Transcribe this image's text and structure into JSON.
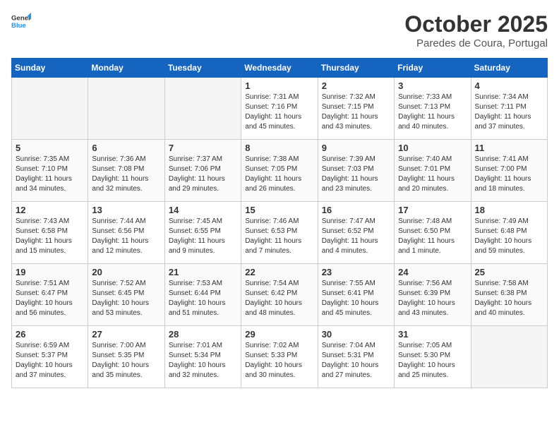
{
  "header": {
    "logo_general": "General",
    "logo_blue": "Blue",
    "month_title": "October 2025",
    "subtitle": "Paredes de Coura, Portugal"
  },
  "weekdays": [
    "Sunday",
    "Monday",
    "Tuesday",
    "Wednesday",
    "Thursday",
    "Friday",
    "Saturday"
  ],
  "weeks": [
    [
      {
        "day": "",
        "info": ""
      },
      {
        "day": "",
        "info": ""
      },
      {
        "day": "",
        "info": ""
      },
      {
        "day": "1",
        "info": "Sunrise: 7:31 AM\nSunset: 7:16 PM\nDaylight: 11 hours\nand 45 minutes."
      },
      {
        "day": "2",
        "info": "Sunrise: 7:32 AM\nSunset: 7:15 PM\nDaylight: 11 hours\nand 43 minutes."
      },
      {
        "day": "3",
        "info": "Sunrise: 7:33 AM\nSunset: 7:13 PM\nDaylight: 11 hours\nand 40 minutes."
      },
      {
        "day": "4",
        "info": "Sunrise: 7:34 AM\nSunset: 7:11 PM\nDaylight: 11 hours\nand 37 minutes."
      }
    ],
    [
      {
        "day": "5",
        "info": "Sunrise: 7:35 AM\nSunset: 7:10 PM\nDaylight: 11 hours\nand 34 minutes."
      },
      {
        "day": "6",
        "info": "Sunrise: 7:36 AM\nSunset: 7:08 PM\nDaylight: 11 hours\nand 32 minutes."
      },
      {
        "day": "7",
        "info": "Sunrise: 7:37 AM\nSunset: 7:06 PM\nDaylight: 11 hours\nand 29 minutes."
      },
      {
        "day": "8",
        "info": "Sunrise: 7:38 AM\nSunset: 7:05 PM\nDaylight: 11 hours\nand 26 minutes."
      },
      {
        "day": "9",
        "info": "Sunrise: 7:39 AM\nSunset: 7:03 PM\nDaylight: 11 hours\nand 23 minutes."
      },
      {
        "day": "10",
        "info": "Sunrise: 7:40 AM\nSunset: 7:01 PM\nDaylight: 11 hours\nand 20 minutes."
      },
      {
        "day": "11",
        "info": "Sunrise: 7:41 AM\nSunset: 7:00 PM\nDaylight: 11 hours\nand 18 minutes."
      }
    ],
    [
      {
        "day": "12",
        "info": "Sunrise: 7:43 AM\nSunset: 6:58 PM\nDaylight: 11 hours\nand 15 minutes."
      },
      {
        "day": "13",
        "info": "Sunrise: 7:44 AM\nSunset: 6:56 PM\nDaylight: 11 hours\nand 12 minutes."
      },
      {
        "day": "14",
        "info": "Sunrise: 7:45 AM\nSunset: 6:55 PM\nDaylight: 11 hours\nand 9 minutes."
      },
      {
        "day": "15",
        "info": "Sunrise: 7:46 AM\nSunset: 6:53 PM\nDaylight: 11 hours\nand 7 minutes."
      },
      {
        "day": "16",
        "info": "Sunrise: 7:47 AM\nSunset: 6:52 PM\nDaylight: 11 hours\nand 4 minutes."
      },
      {
        "day": "17",
        "info": "Sunrise: 7:48 AM\nSunset: 6:50 PM\nDaylight: 11 hours\nand 1 minute."
      },
      {
        "day": "18",
        "info": "Sunrise: 7:49 AM\nSunset: 6:48 PM\nDaylight: 10 hours\nand 59 minutes."
      }
    ],
    [
      {
        "day": "19",
        "info": "Sunrise: 7:51 AM\nSunset: 6:47 PM\nDaylight: 10 hours\nand 56 minutes."
      },
      {
        "day": "20",
        "info": "Sunrise: 7:52 AM\nSunset: 6:45 PM\nDaylight: 10 hours\nand 53 minutes."
      },
      {
        "day": "21",
        "info": "Sunrise: 7:53 AM\nSunset: 6:44 PM\nDaylight: 10 hours\nand 51 minutes."
      },
      {
        "day": "22",
        "info": "Sunrise: 7:54 AM\nSunset: 6:42 PM\nDaylight: 10 hours\nand 48 minutes."
      },
      {
        "day": "23",
        "info": "Sunrise: 7:55 AM\nSunset: 6:41 PM\nDaylight: 10 hours\nand 45 minutes."
      },
      {
        "day": "24",
        "info": "Sunrise: 7:56 AM\nSunset: 6:39 PM\nDaylight: 10 hours\nand 43 minutes."
      },
      {
        "day": "25",
        "info": "Sunrise: 7:58 AM\nSunset: 6:38 PM\nDaylight: 10 hours\nand 40 minutes."
      }
    ],
    [
      {
        "day": "26",
        "info": "Sunrise: 6:59 AM\nSunset: 5:37 PM\nDaylight: 10 hours\nand 37 minutes."
      },
      {
        "day": "27",
        "info": "Sunrise: 7:00 AM\nSunset: 5:35 PM\nDaylight: 10 hours\nand 35 minutes."
      },
      {
        "day": "28",
        "info": "Sunrise: 7:01 AM\nSunset: 5:34 PM\nDaylight: 10 hours\nand 32 minutes."
      },
      {
        "day": "29",
        "info": "Sunrise: 7:02 AM\nSunset: 5:33 PM\nDaylight: 10 hours\nand 30 minutes."
      },
      {
        "day": "30",
        "info": "Sunrise: 7:04 AM\nSunset: 5:31 PM\nDaylight: 10 hours\nand 27 minutes."
      },
      {
        "day": "31",
        "info": "Sunrise: 7:05 AM\nSunset: 5:30 PM\nDaylight: 10 hours\nand 25 minutes."
      },
      {
        "day": "",
        "info": ""
      }
    ]
  ]
}
